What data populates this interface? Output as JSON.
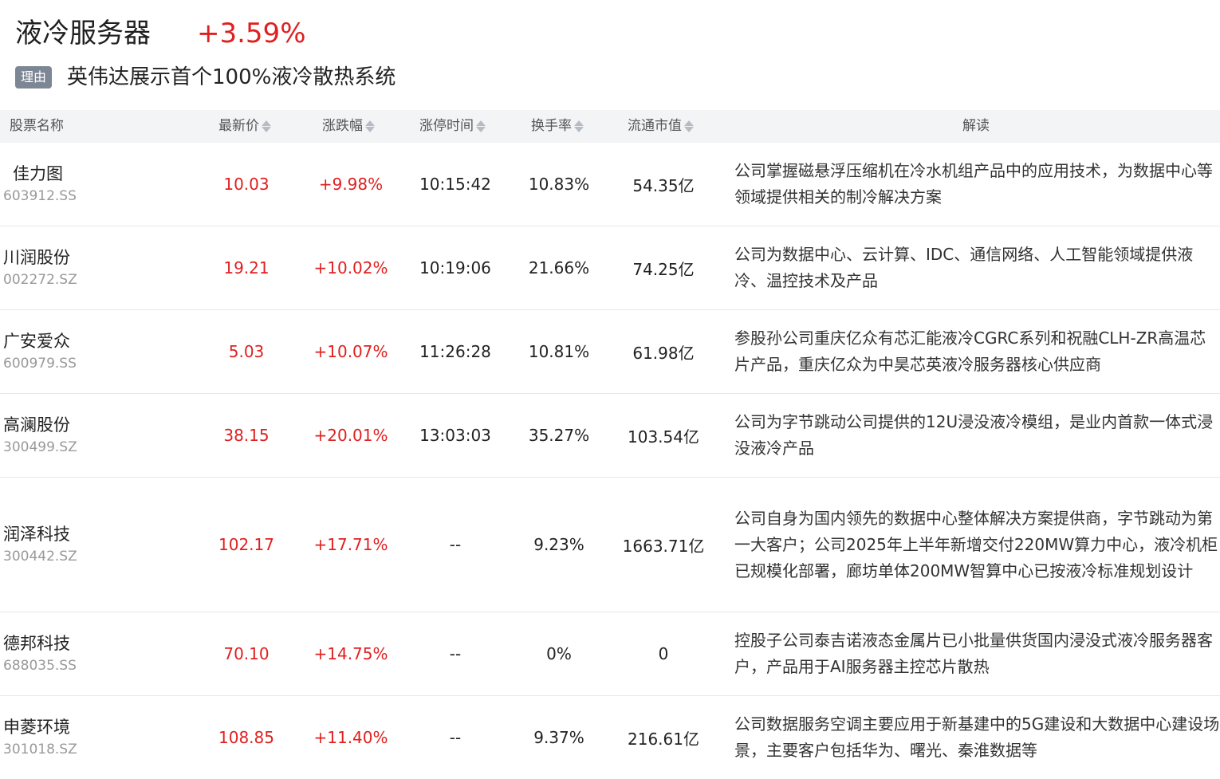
{
  "sector": {
    "name": "液冷服务器",
    "change": "+3.59%"
  },
  "reason": {
    "badge": "理由",
    "text": "英伟达展示首个100%液冷散热系统"
  },
  "table": {
    "headers": {
      "name": "股票名称",
      "price": "最新价",
      "change": "涨跌幅",
      "limit_time": "涨停时间",
      "turnover": "换手率",
      "market_cap": "流通市值",
      "interpretation": "解读"
    },
    "rows": [
      {
        "name": "佳力图",
        "code": "603912.SS",
        "price": "10.03",
        "change": "+9.98%",
        "limit_time": "10:15:42",
        "turnover": "10.83%",
        "market_cap": "54.35亿",
        "interpretation": "公司掌握磁悬浮压缩机在冷水机组产品中的应用技术，为数据中心等领域提供相关的制冷解决方案"
      },
      {
        "name": "川润股份",
        "code": "002272.SZ",
        "price": "19.21",
        "change": "+10.02%",
        "limit_time": "10:19:06",
        "turnover": "21.66%",
        "market_cap": "74.25亿",
        "interpretation": "公司为数据中心、云计算、IDC、通信网络、人工智能领域提供液冷、温控技术及产品"
      },
      {
        "name": "广安爱众",
        "code": "600979.SS",
        "price": "5.03",
        "change": "+10.07%",
        "limit_time": "11:26:28",
        "turnover": "10.81%",
        "market_cap": "61.98亿",
        "interpretation": "参股孙公司重庆亿众有芯汇能液冷CGRC系列和祝融CLH-ZR高温芯片产品，重庆亿众为中昊芯英液冷服务器核心供应商"
      },
      {
        "name": "高澜股份",
        "code": "300499.SZ",
        "price": "38.15",
        "change": "+20.01%",
        "limit_time": "13:03:03",
        "turnover": "35.27%",
        "market_cap": "103.54亿",
        "interpretation": "公司为字节跳动公司提供的12U浸没液冷模组，是业内首款一体式浸没液冷产品"
      },
      {
        "name": "润泽科技",
        "code": "300442.SZ",
        "price": "102.17",
        "change": "+17.71%",
        "limit_time": "--",
        "turnover": "9.23%",
        "market_cap": "1663.71亿",
        "interpretation": "公司自身为国内领先的数据中心整体解决方案提供商，字节跳动为第一大客户；公司2025年上半年新增交付220MW算力中心，液冷机柜已规模化部署，廊坊单体200MW智算中心已按液冷标准规划设计"
      },
      {
        "name": "德邦科技",
        "code": "688035.SS",
        "price": "70.10",
        "change": "+14.75%",
        "limit_time": "--",
        "turnover": "0%",
        "market_cap": "0",
        "interpretation": "控股子公司泰吉诺液态金属片已小批量供货国内浸没式液冷服务器客户，产品用于AI服务器主控芯片散热"
      },
      {
        "name": "申菱环境",
        "code": "301018.SZ",
        "price": "108.85",
        "change": "+11.40%",
        "limit_time": "--",
        "turnover": "9.37%",
        "market_cap": "216.61亿",
        "interpretation": "公司数据服务空调主要应用于新基建中的5G建设和大数据中心建设场景，主要客户包括华为、曙光、秦淮数据等"
      }
    ]
  }
}
